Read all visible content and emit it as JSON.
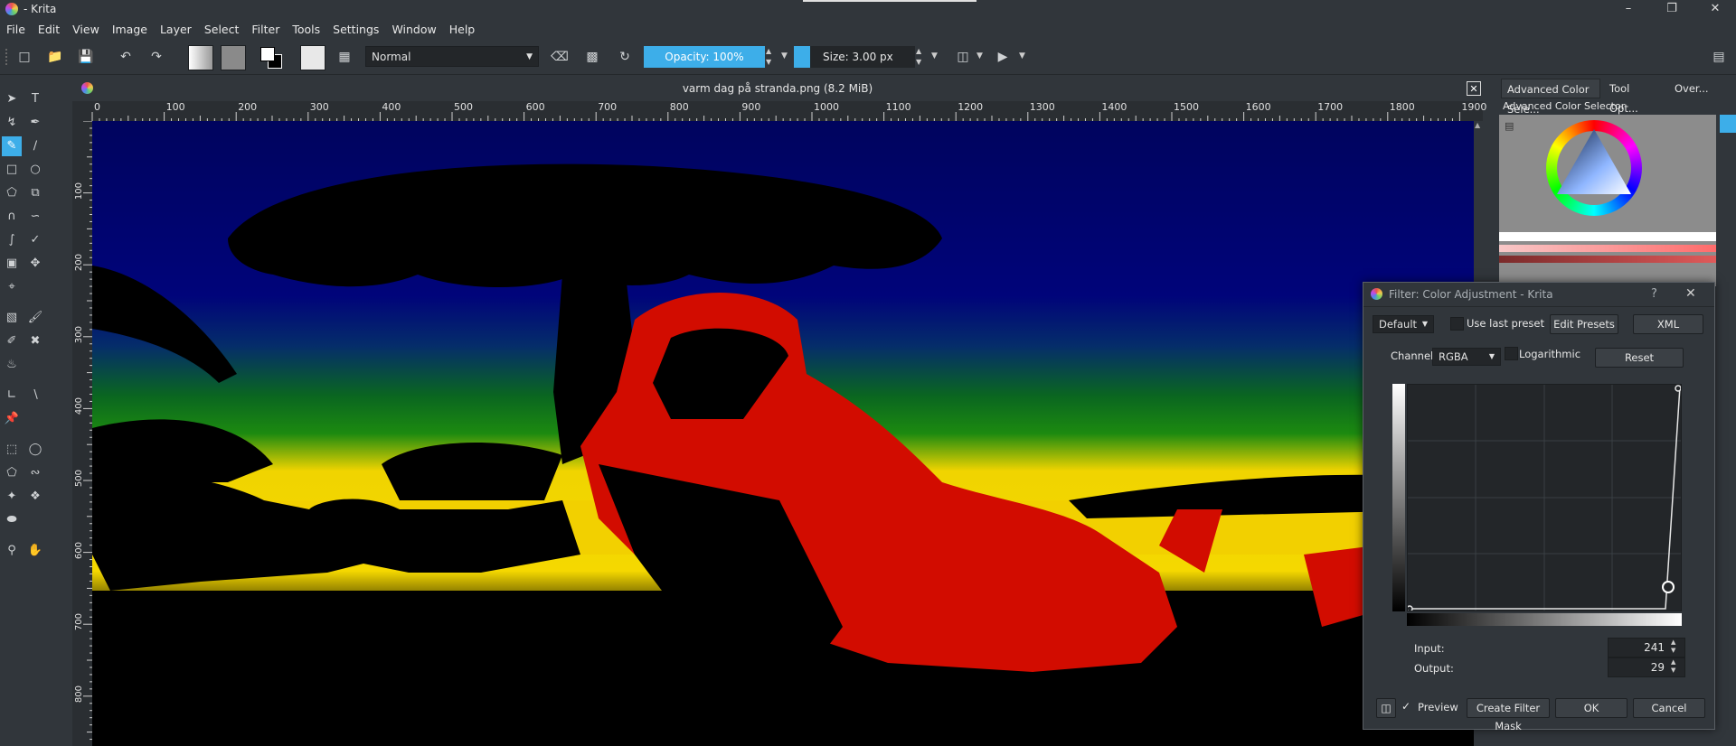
{
  "window": {
    "title": "- Krita",
    "controls": [
      "–",
      "❐",
      "✕"
    ]
  },
  "menu": [
    "File",
    "Edit",
    "View",
    "Image",
    "Layer",
    "Select",
    "Filter",
    "Tools",
    "Settings",
    "Window",
    "Help"
  ],
  "toolbar": {
    "blend_mode": "Normal",
    "opacity_label": "Opacity: 100%",
    "size_label": "Size: 3.00 px"
  },
  "document": {
    "tab_title": "varm dag på stranda.png (8.2 MiB)",
    "ruler_h": [
      "0",
      "100",
      "200",
      "300",
      "400",
      "500",
      "600",
      "700",
      "800",
      "900",
      "1000",
      "1100",
      "1200",
      "1300",
      "1400",
      "1500",
      "1600",
      "1700",
      "1800",
      "1900"
    ],
    "ruler_v": [
      "100",
      "200",
      "300",
      "400",
      "500",
      "600",
      "700",
      "800"
    ]
  },
  "dock": {
    "tabs": [
      "Advanced Color Sele...",
      "Tool Opt...",
      "Over..."
    ],
    "panel_title": "Advanced Color Selector"
  },
  "dialog": {
    "title": "Filter: Color Adjustment - Krita",
    "help": "?",
    "close": "✕",
    "preset": "Default",
    "use_last_preset": "Use last preset",
    "edit_presets": "Edit Presets",
    "xml": "XML",
    "channel_label": "Channel:",
    "channel_value": "RGBA",
    "logarithmic": "Logarithmic",
    "reset": "Reset",
    "input_label": "Input:",
    "input_value": "241",
    "output_label": "Output:",
    "output_value": "29",
    "preview": "Preview",
    "create_filter_mask": "Create Filter Mask",
    "ok": "OK",
    "cancel": "Cancel"
  },
  "colors": {
    "accent": "#3daee9",
    "bg": "#31363b",
    "canvas_red": "#d20c00",
    "canvas_yellow": "#f2d000",
    "canvas_blue": "#00046a"
  }
}
